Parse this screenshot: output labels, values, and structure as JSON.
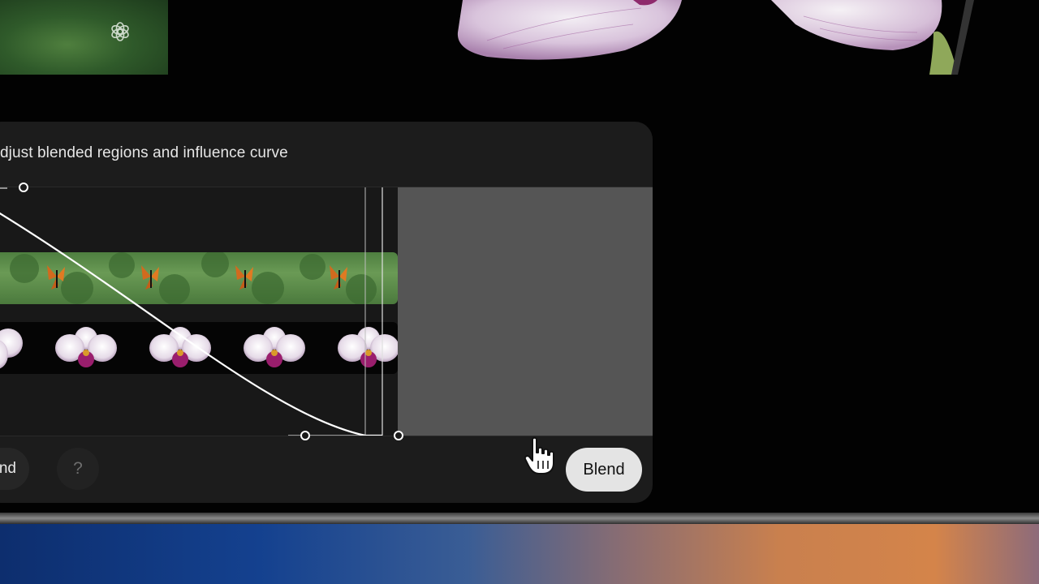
{
  "panel": {
    "title": "djust blended regions and influence curve"
  },
  "controls": {
    "blend_left_label": "lend",
    "help_label": "?",
    "blend_label": "Blend"
  },
  "icons": {
    "logo": "openai-logo-icon",
    "cursor": "hand-pointer-icon"
  },
  "colors": {
    "panel_bg": "#1c1c1c",
    "gray_region": "#555555",
    "blend_button_bg": "#e4e4e4"
  }
}
